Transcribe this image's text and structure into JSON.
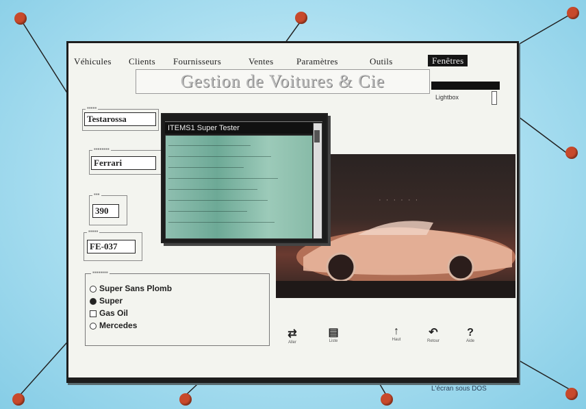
{
  "menu": {
    "items": [
      "Véhicules",
      "Clients",
      "Fournisseurs",
      "Ventes",
      "Paramètres",
      "Outils"
    ],
    "active": "Fenêtres"
  },
  "header": {
    "title": "Gestion de Voitures & Cie",
    "date_value": "Lightbox"
  },
  "form": {
    "marque_value": "Testarossa",
    "modele_value": "Ferrari",
    "cv_value": "390",
    "immat_value": "FE-037"
  },
  "radio_group": {
    "options": [
      "Super Sans Plomb",
      "Super",
      "Gas Oil",
      "Mercedes"
    ],
    "selected_index": 1
  },
  "dialog": {
    "title": "ITEMS1   Super Tester"
  },
  "toolbar": {
    "items": [
      {
        "glyph": "⇄",
        "label": "Aller",
        "icon": "transfer-icon"
      },
      {
        "glyph": "▤",
        "label": "Liste",
        "icon": "list-icon"
      },
      {
        "glyph": "↑",
        "label": "Haut",
        "icon": "up-icon"
      },
      {
        "glyph": "↶",
        "label": "Retour",
        "icon": "back-icon"
      },
      {
        "glyph": "?",
        "label": "Aide",
        "icon": "help-icon"
      }
    ]
  },
  "caption": "L'écran sous DOS",
  "colors": {
    "callout": "#c8492b",
    "background": "#a9def0",
    "screen": "#f3f4ef"
  }
}
